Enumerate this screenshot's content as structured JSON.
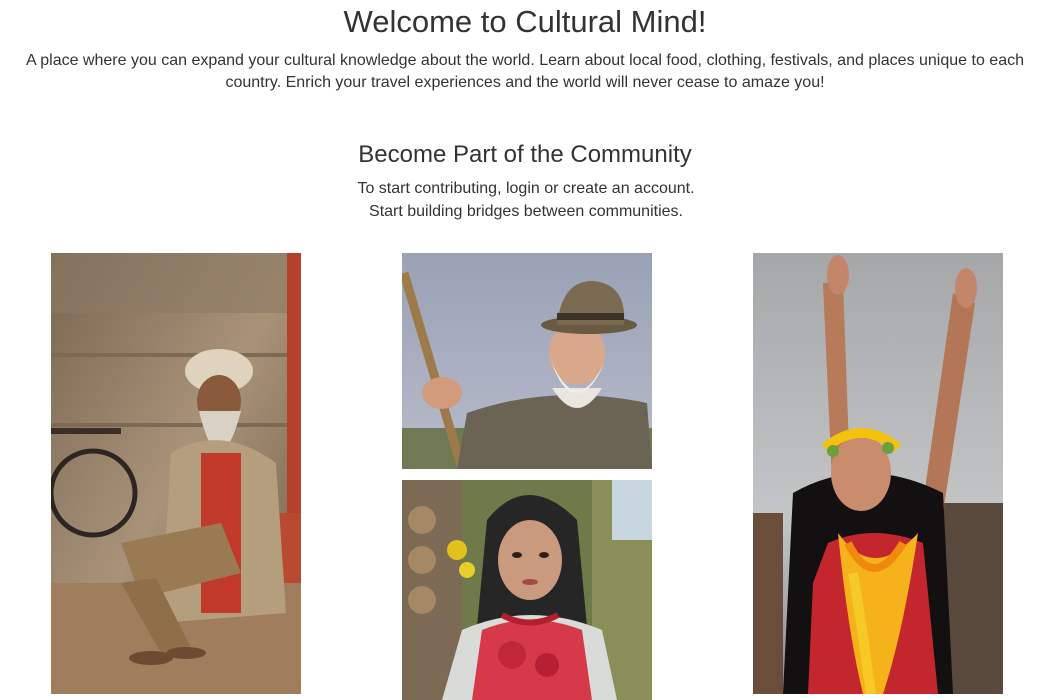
{
  "hero": {
    "title": "Welcome to Cultural Mind!",
    "description": "A place where you can expand your cultural knowledge about the world. Learn about local food, clothing, festivals, and places unique to each country. Enrich your travel experiences and the world will never cease to amaze you!"
  },
  "community": {
    "title": "Become Part of the Community",
    "line1": "To start contributing, login or create an account.",
    "line2": "Start building bridges between communities."
  },
  "colors": {
    "text": "#333333",
    "background": "#ffffff"
  }
}
